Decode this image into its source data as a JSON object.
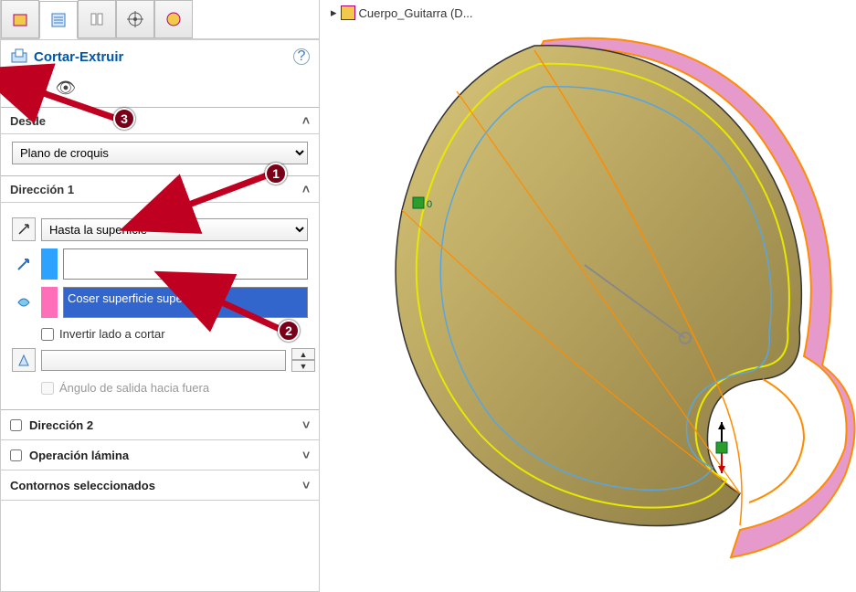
{
  "breadcrumb": {
    "label": "Cuerpo_Guitarra (D..."
  },
  "feature": {
    "title": "Cortar-Extruir",
    "sections": {
      "desde": {
        "label": "Desde",
        "value": "Plano de croquis"
      },
      "dir1": {
        "label": "Dirección 1",
        "end_condition": "Hasta la superficie",
        "surface_selection": "Coser superficie superior",
        "invert_side": "Invertir lado a cortar",
        "draft_outward": "Ángulo de salida hacia fuera"
      },
      "dir2": {
        "label": "Dirección 2"
      },
      "lamina": {
        "label": "Operación lámina"
      },
      "contornos": {
        "label": "Contornos seleccionados"
      }
    }
  },
  "callouts": {
    "c1": "1",
    "c2": "2",
    "c3": "3"
  }
}
